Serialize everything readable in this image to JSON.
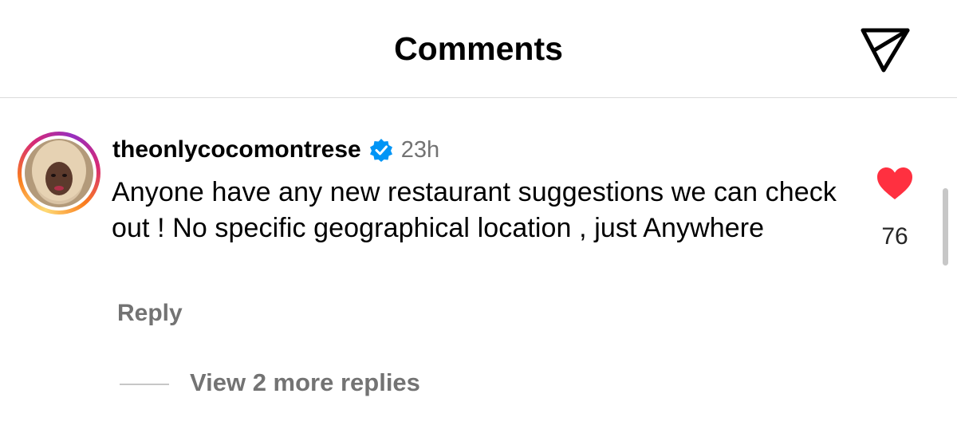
{
  "header": {
    "title": "Comments",
    "send_icon": "paper-plane-icon"
  },
  "comment": {
    "avatar_icon": "profile-avatar",
    "username": "theonlycocomontrese",
    "verified": true,
    "verified_color": "#0095f6",
    "timestamp": "23h",
    "text": "Anyone have any new restaurant suggestions we can check out ! No specific geographical location , just Anywhere",
    "reply_label": "Reply",
    "like_icon": "heart-filled-icon",
    "like_color": "#ff3040",
    "like_count": "76",
    "view_replies_label": "View 2 more replies"
  }
}
